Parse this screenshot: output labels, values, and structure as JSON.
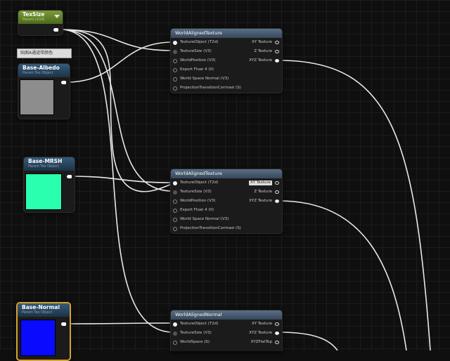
{
  "colors": {
    "wire": "#e8e8e8",
    "albedo_swatch": "#8d8d8d",
    "mrsh_swatch": "#2affb0",
    "normal_swatch": "#0a0aff",
    "selection": "#d9a230"
  },
  "comment_text": "贴图A通道带颜色",
  "param_nodes": {
    "texsize": {
      "title": "TexSize",
      "subtitle": "Param (1)(4)"
    },
    "albedo": {
      "title": "Base-Albedo",
      "subtitle": "Param Tex Object"
    },
    "mrsh": {
      "title": "Base-MRSH",
      "subtitle": "Param Tex Object"
    },
    "normal": {
      "title": "Base-Normal",
      "subtitle": "Param Tex Object"
    }
  },
  "fn_nodes": {
    "wat1": {
      "title": "WorldAlignedTexture",
      "inputs": [
        "TextureObject (T2d)",
        "TextureSize (V3)",
        "WorldPosition (V3)",
        "Export Float 4 (0)",
        "World Space Normal (V3)",
        "ProjectionTransitionContrast (S)"
      ],
      "outputs": [
        "XY Texture",
        "Z Texture",
        "XYZ Texture"
      ]
    },
    "wat2": {
      "title": "WorldAlignedTexture",
      "inputs": [
        "TextureObject (T2d)",
        "TextureSize (V3)",
        "WorldPosition (V3)",
        "Export Float 4 (0)",
        "World Space Normal (V3)",
        "ProjectionTransitionContrast (S)"
      ],
      "outputs": [
        "XY Texture",
        "Z Texture",
        "XYZ Texture"
      ]
    },
    "wan": {
      "title": "WorldAlignedNormal",
      "inputs": [
        "TextureObject (T2d)",
        "TextureSize (V3)",
        "WorldSpace (S)"
      ],
      "outputs": [
        "XY Texture",
        "XYZ Texture",
        "XYZFlatTop"
      ]
    }
  }
}
